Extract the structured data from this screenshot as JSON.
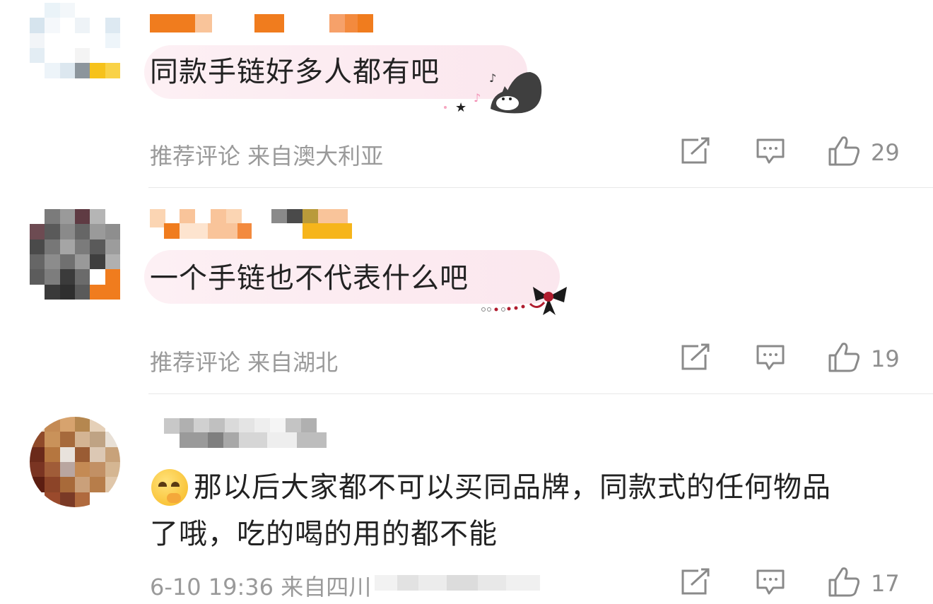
{
  "comments": [
    {
      "text": "同款手链好多人都有吧",
      "meta": "推荐评论 来自澳大利亚",
      "likes": "29"
    },
    {
      "text": "一个手链也不代表什么吧",
      "meta": "推荐评论 来自湖北",
      "likes": "19"
    },
    {
      "text_line1": "那以后大家都不可以买同品牌，同款式的任何物品",
      "text_line2": "了哦，吃的喝的用的都不能",
      "meta": "6-10 19:36 来自四川",
      "likes": "17"
    }
  ],
  "icons": {
    "repost": "repost-icon",
    "comment": "comment-icon",
    "like": "thumbs-up-icon"
  },
  "colors": {
    "bubble": "#fbe7ee",
    "meta_text": "#9a9a9a",
    "icon_stroke": "#8a8a8a",
    "divider": "#e8e8e8",
    "username_orange": "#f07c1e"
  }
}
